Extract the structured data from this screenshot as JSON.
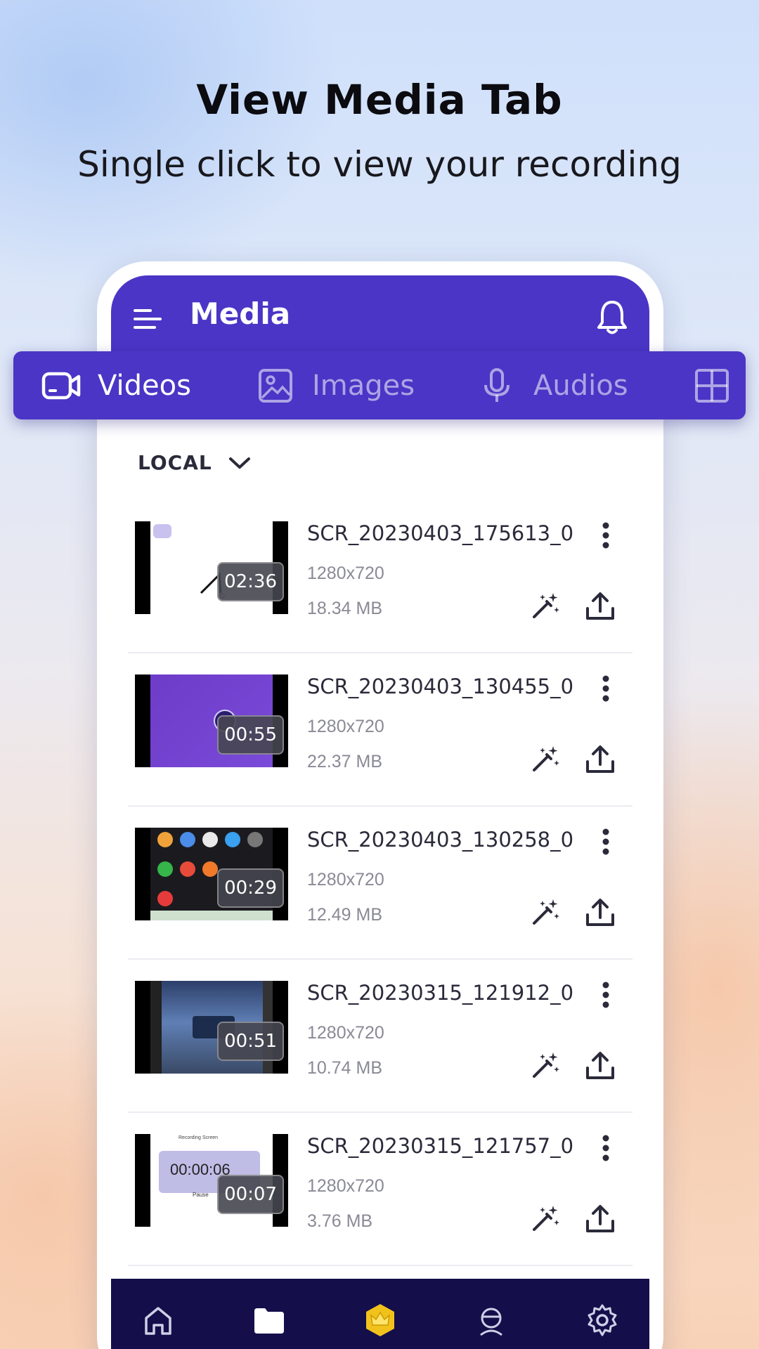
{
  "headline": "View Media Tab",
  "subline": "Single click to view your recording",
  "appbar": {
    "title": "Media",
    "menu_icon": "menu-icon",
    "bell_icon": "bell-icon"
  },
  "tabs": [
    {
      "label": "Videos",
      "icon": "video-camera-icon",
      "active": true
    },
    {
      "label": "Images",
      "icon": "image-icon",
      "active": false
    },
    {
      "label": "Audios",
      "icon": "microphone-icon",
      "active": false
    },
    {
      "label": "",
      "icon": "grid-icon",
      "active": false
    }
  ],
  "filter": {
    "label": "LOCAL",
    "icon": "chevron-down-icon"
  },
  "videos": [
    {
      "name": "SCR_20230403_175613_0",
      "resolution": "1280x720",
      "size": "18.34 MB",
      "duration": "02:36"
    },
    {
      "name": "SCR_20230403_130455_0",
      "resolution": "1280x720",
      "size": "22.37 MB",
      "duration": "00:55"
    },
    {
      "name": "SCR_20230403_130258_0",
      "resolution": "1280x720",
      "size": "12.49 MB",
      "duration": "00:29"
    },
    {
      "name": "SCR_20230315_121912_0",
      "resolution": "1280x720",
      "size": "10.74 MB",
      "duration": "00:51"
    },
    {
      "name": "SCR_20230315_121757_0",
      "resolution": "1280x720",
      "size": "3.76 MB",
      "duration": "00:07"
    }
  ],
  "thumb_texts": {
    "recording_screen": "Recording Screen",
    "timer": "00:00:06",
    "pause": "Pause"
  },
  "bottom_nav": [
    "home-icon",
    "folder-icon",
    "crown-premium-icon",
    "profile-tools-icon",
    "settings-icon"
  ],
  "colors": {
    "primary": "#4a35c6",
    "bottom_nav": "#140e4a",
    "text_dark": "#2a2a3a",
    "text_muted": "#8a8a96"
  }
}
